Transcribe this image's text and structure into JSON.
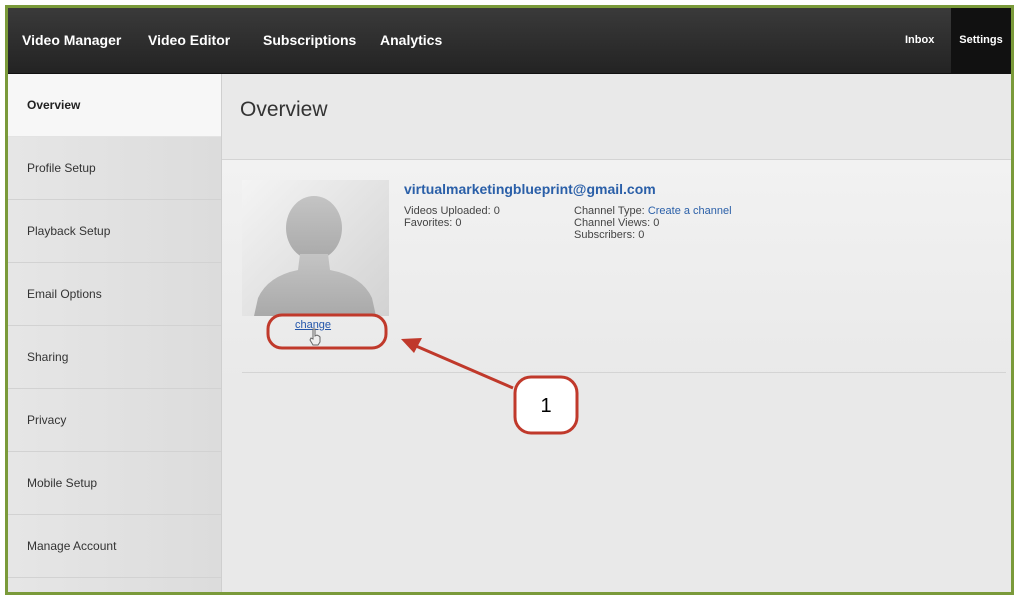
{
  "nav": {
    "video_manager": "Video Manager",
    "video_editor": "Video Editor",
    "subscriptions": "Subscriptions",
    "analytics": "Analytics",
    "inbox": "Inbox",
    "settings": "Settings"
  },
  "sidebar": {
    "items": [
      {
        "label": "Overview"
      },
      {
        "label": "Profile Setup"
      },
      {
        "label": "Playback Setup"
      },
      {
        "label": "Email Options"
      },
      {
        "label": "Sharing"
      },
      {
        "label": "Privacy"
      },
      {
        "label": "Mobile Setup"
      },
      {
        "label": "Manage Account"
      }
    ],
    "active_index": 0
  },
  "main": {
    "title": "Overview",
    "profile": {
      "email": "virtualmarketingblueprint@gmail.com",
      "change_label": "change",
      "videos_uploaded": "Videos Uploaded: 0",
      "favorites": "Favorites: 0",
      "channel_type_label": "Channel Type:",
      "channel_type_link": "Create a channel",
      "channel_views": "Channel Views: 0",
      "subscribers": "Subscribers: 0"
    }
  },
  "annotation": {
    "number": "1",
    "color": "#c0392b"
  },
  "colors": {
    "frame_border": "#7a9a3a",
    "link": "#2a5fa8",
    "nav_bg": "#2b2b2b"
  }
}
